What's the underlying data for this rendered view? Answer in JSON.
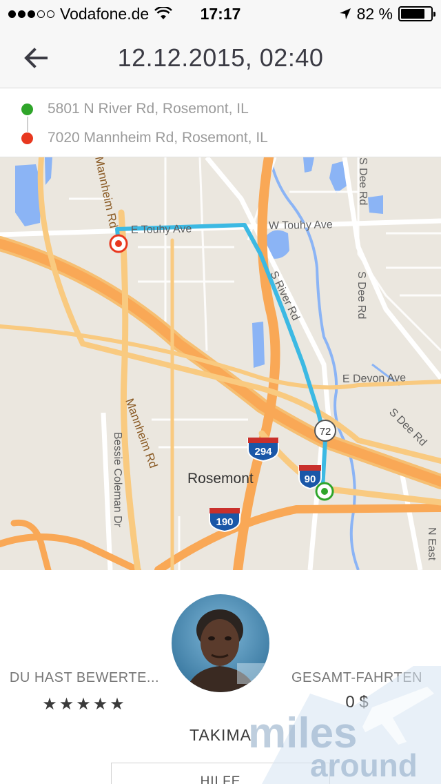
{
  "status_bar": {
    "carrier": "Vodafone.de",
    "time": "17:17",
    "battery": "82 %",
    "battery_level": 0.82,
    "signal_bars": 3,
    "signal_total": 5
  },
  "header": {
    "title": "12.12.2015, 02:40",
    "back_icon": "arrow-left-icon"
  },
  "trip": {
    "pickup": "5801 N River Rd, Rosemont, IL",
    "dropoff": "7020 Mannheim Rd, Rosemont, IL",
    "pickup_color": "#2fa52a",
    "dropoff_color": "#e8381f"
  },
  "map": {
    "labels": {
      "touhy_west": "E Touhy Ave",
      "touhy_east": "W Touhy Ave",
      "mannheim_north": "Mannheim Rd",
      "mannheim_south": "Mannheim Rd",
      "river_rd": "S River Rd",
      "devon": "E Devon Ave",
      "dee_rd_north": "S Dee Rd",
      "dee_rd_mid": "S Dee Rd",
      "dee_rd_east": "S Dee Rd",
      "bessie": "Bessie Coleman Dr",
      "east_edge": "N East",
      "city": "Rosemont",
      "i294": "294",
      "i90": "90",
      "i190": "190",
      "route72": "72"
    },
    "route_color": "#3cb9e3"
  },
  "rating": {
    "label": "DU HAST BEWERTE...",
    "stars": "★★★★★"
  },
  "fare": {
    "label": "GESAMT-FAHRTEN",
    "value": "0 $"
  },
  "driver": {
    "name": "TAKIMA"
  },
  "help_button": {
    "label": "HILFE"
  },
  "watermark": {
    "line1": "miles",
    "line2": "around"
  }
}
